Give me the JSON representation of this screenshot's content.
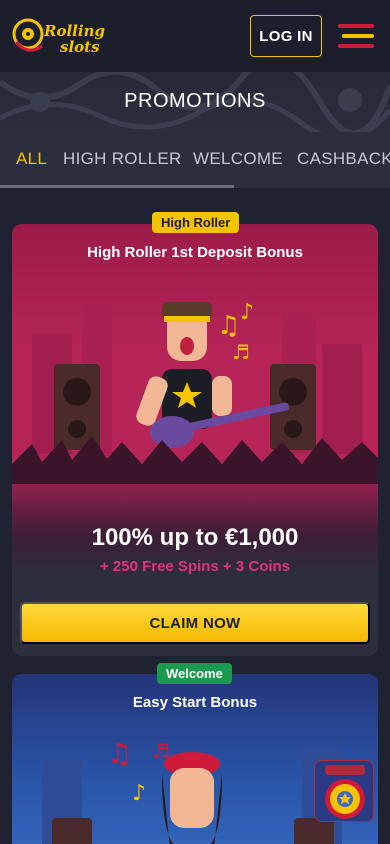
{
  "brand": {
    "logo_text_1": "Rolling",
    "logo_text_2": "slots"
  },
  "header": {
    "login_label": "LOG IN"
  },
  "hero": {
    "title": "PROMOTIONS"
  },
  "tabs": [
    {
      "label": "ALL",
      "active": true
    },
    {
      "label": "HIGH ROLLER"
    },
    {
      "label": "WELCOME"
    },
    {
      "label": "CASHBACK"
    }
  ],
  "promotions": [
    {
      "badge": "High Roller",
      "title": "High Roller 1st Deposit Bonus",
      "offer": "100% up to €1,000",
      "extras": "+ 250 Free Spins + 3 Coins",
      "cta": "CLAIM NOW"
    },
    {
      "badge": "Welcome",
      "title": "Easy Start Bonus"
    }
  ],
  "colors": {
    "accent": "#f5c400",
    "pink": "#e0337a",
    "welcome": "#1a9a4e",
    "bg": "#1f2230"
  }
}
